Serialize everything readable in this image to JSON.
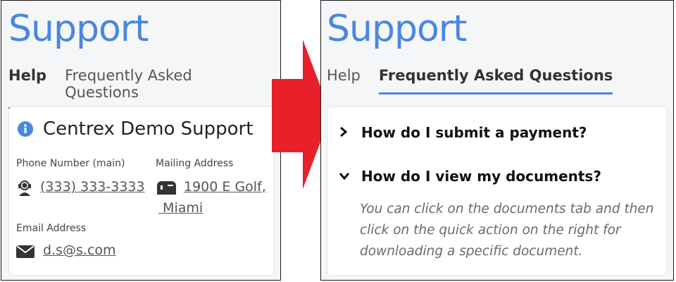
{
  "left": {
    "title": "Support",
    "tabs": [
      {
        "label": "Help",
        "active": true
      },
      {
        "label": "Frequently Asked Questions",
        "active": false
      }
    ],
    "card": {
      "heading": "Centrex Demo Support",
      "phone_label": "Phone Number (main)",
      "phone_value": "(333) 333-3333",
      "mailing_label": "Mailing Address",
      "mailing_line1": "1900 E Golf,",
      "mailing_line2": "Miami",
      "email_label": "Email Address",
      "email_value": "d.s@s.com"
    }
  },
  "right": {
    "title": "Support",
    "tabs": [
      {
        "label": "Help",
        "active": false
      },
      {
        "label": "Frequently Asked Questions",
        "active": true
      }
    ],
    "faq": [
      {
        "question": "How do I submit a payment?",
        "expanded": false
      },
      {
        "question": "How do I view my documents?",
        "expanded": true,
        "answer": "You can click on the documents tab and then click on the quick action on the right for downloading a  specific document."
      }
    ]
  },
  "colors": {
    "accent": "#4a86e0",
    "arrow": "#e8202a",
    "background": "#f5f6f8"
  },
  "icons": [
    "info-icon",
    "support-agent-icon",
    "mailbox-icon",
    "envelope-icon",
    "chevron-right-icon",
    "chevron-down-icon",
    "big-right-arrow-icon"
  ]
}
